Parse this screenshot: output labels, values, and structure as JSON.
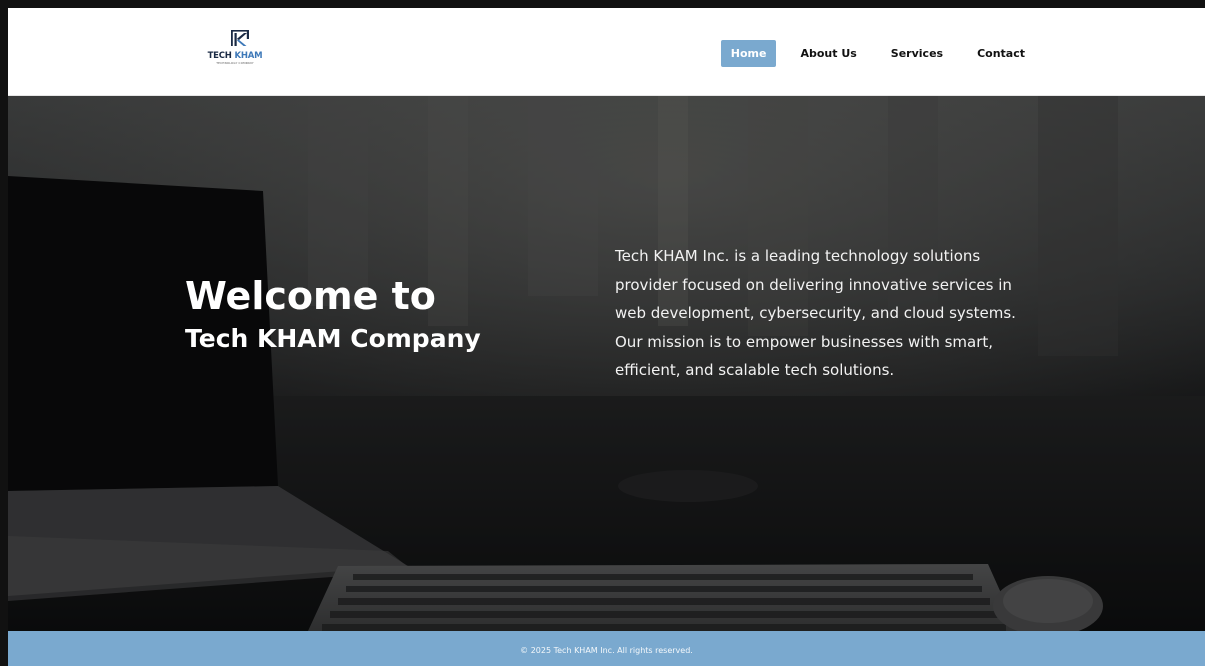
{
  "brand": {
    "logo_text_primary": "TECH",
    "logo_text_accent": "KHAM",
    "logo_tagline": "TECHNOLOGY COMPANY",
    "colors": {
      "navy": "#1a2a44",
      "blue": "#3d78b8"
    }
  },
  "nav": {
    "items": [
      {
        "label": "Home",
        "active": true
      },
      {
        "label": "About Us",
        "active": false
      },
      {
        "label": "Services",
        "active": false
      },
      {
        "label": "Contact",
        "active": false
      }
    ],
    "active_color": "#7aa9cf"
  },
  "hero": {
    "title_line1": "Welcome to",
    "title_line2": "Tech KHAM Company",
    "description": "Tech KHAM Inc. is a leading technology solutions provider focused on delivering innovative services in web development, cybersecurity, and cloud systems. Our mission is to empower businesses with smart, efficient, and scalable tech solutions."
  },
  "footer": {
    "copyright": "© 2025 Tech KHAM Inc. All rights reserved.",
    "background": "#7aa9cf"
  }
}
